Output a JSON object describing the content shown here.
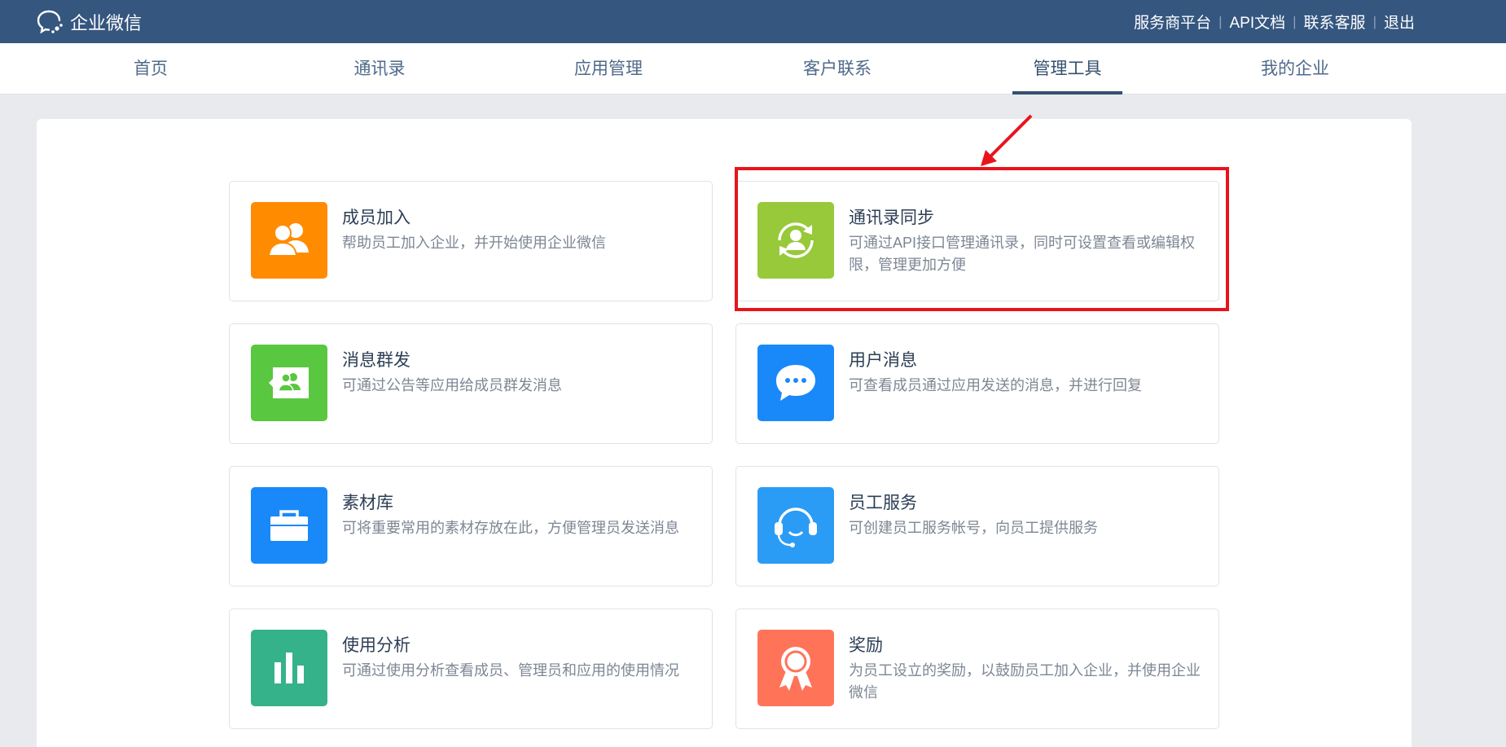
{
  "app": {
    "title": "企业微信"
  },
  "toplinks": [
    {
      "label": "服务商平台"
    },
    {
      "label": "API文档"
    },
    {
      "label": "联系客服"
    },
    {
      "label": "退出"
    }
  ],
  "nav": {
    "active": "管理工具",
    "tabs": [
      {
        "label": "首页"
      },
      {
        "label": "通讯录"
      },
      {
        "label": "应用管理"
      },
      {
        "label": "客户联系"
      },
      {
        "label": "管理工具"
      },
      {
        "label": "我的企业"
      }
    ]
  },
  "cards": [
    {
      "title": "成员加入",
      "desc": "帮助员工加入企业，并开始使用企业微信",
      "icon": "members-join-icon",
      "color": "#ff8c00"
    },
    {
      "title": "通讯录同步",
      "desc": "可通过API接口管理通讯录，同时可设置查看或编辑权限，管理更加方便",
      "icon": "contacts-sync-icon",
      "color": "#97c93a"
    },
    {
      "title": "消息群发",
      "desc": "可通过公告等应用给成员群发消息",
      "icon": "broadcast-message-icon",
      "color": "#59c740"
    },
    {
      "title": "用户消息",
      "desc": "可查看成员通过应用发送的消息，并进行回复",
      "icon": "chat-bubble-icon",
      "color": "#1989fa"
    },
    {
      "title": "素材库",
      "desc": "可将重要常用的素材存放在此，方便管理员发送消息",
      "icon": "briefcase-icon",
      "color": "#1989fa"
    },
    {
      "title": "员工服务",
      "desc": "可创建员工服务帐号，向员工提供服务",
      "icon": "headset-icon",
      "color": "#2b9cf5"
    },
    {
      "title": "使用分析",
      "desc": "可通过使用分析查看成员、管理员和应用的使用情况",
      "icon": "bar-chart-icon",
      "color": "#35b28a"
    },
    {
      "title": "奖励",
      "desc": "为员工设立的奖励，以鼓励员工加入企业，并使用企业微信",
      "icon": "award-medal-icon",
      "color": "#ff7459"
    }
  ],
  "annotation": {
    "highlight_color": "#e8141b",
    "target": "通讯录同步"
  }
}
